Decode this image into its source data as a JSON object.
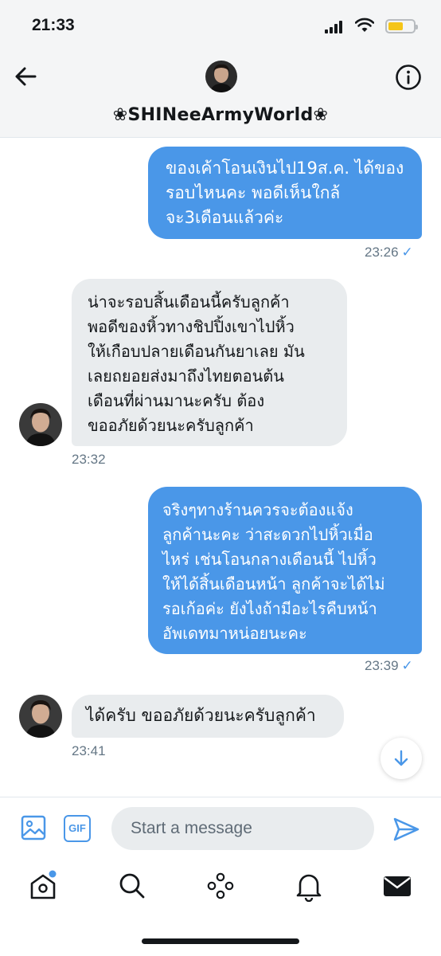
{
  "status_bar": {
    "time": "21:33"
  },
  "header": {
    "title": "❀SHINeeArmyWorld❀",
    "back_icon": "back-arrow-icon",
    "info_icon": "info-icon"
  },
  "messages": [
    {
      "direction": "outgoing",
      "lines": [
        "ของเค้าโอนเงินไป19ส.ค. ได้ของ",
        "รอบไหนคะ พอดีเห็นใกล้",
        "จะ3เดือนแล้วค่ะ"
      ],
      "time": "23:26",
      "status": "✓"
    },
    {
      "direction": "incoming",
      "lines": [
        "น่าจะรอบสิ้นเดือนนี้ครับลูกค้า",
        "พอดีของหิ้วทางชิปปิ้งเขาไปหิ้ว",
        "ให้เกือบปลายเดือนกันยาเลย มัน",
        "เลยถยอยส่งมาถึงไทยตอนต้น",
        "เดือนที่ผ่านมานะครับ ต้อง",
        "ขออภัยด้วยนะครับลูกค้า"
      ],
      "time": "23:32"
    },
    {
      "direction": "outgoing",
      "lines": [
        "จริงๆทางร้านควรจะต้องแจ้ง",
        "ลูกค้านะคะ ว่าสะดวกไปหิ้วเมื่อ",
        "ไหร่ เช่นโอนกลางเดือนนี้ ไปหิ้ว",
        "ให้ได้สิ้นเดือนหน้า ลูกค้าจะได้ไม่",
        "รอเก้อค่ะ ยังไงถ้ามีอะไรคืบหน้า",
        "อัพเดทมาหน่อยนะคะ"
      ],
      "time": "23:39",
      "status": "✓"
    },
    {
      "direction": "incoming",
      "lines": [
        "ได้ครับ ขออภัยด้วยนะครับลูกค้า"
      ],
      "time": "23:41"
    }
  ],
  "composer": {
    "placeholder": "Start a message",
    "gif_label": "GIF"
  },
  "tabbar": [
    "home-icon",
    "search-icon",
    "spaces-icon",
    "notifications-icon",
    "messages-icon"
  ],
  "colors": {
    "accent": "#4a97e8",
    "incoming_bubble": "#e9ecee",
    "notification_dot": "#4a97e8"
  }
}
